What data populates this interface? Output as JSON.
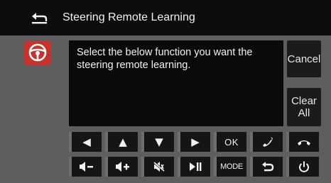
{
  "header": {
    "title": "Steering Remote Learning",
    "back_icon": "back-arrow-icon"
  },
  "panel": {
    "icon": "steering-wheel-icon",
    "message": "Select the below function you want the steering remote learning.",
    "cancel_label": "Cancel",
    "clear_all_label": "Clear All"
  },
  "keys_row1": [
    {
      "name": "key-seek-left",
      "icon": "left-triangle-icon",
      "glyph": "◀"
    },
    {
      "name": "key-up",
      "icon": "up-triangle-icon",
      "glyph": "▲"
    },
    {
      "name": "key-down",
      "icon": "down-triangle-icon",
      "glyph": "▼"
    },
    {
      "name": "key-seek-right",
      "icon": "right-triangle-icon",
      "glyph": "▶"
    },
    {
      "name": "key-ok",
      "label": "OK"
    },
    {
      "name": "key-call",
      "icon": "phone-answer-icon"
    },
    {
      "name": "key-hangup",
      "icon": "phone-hangup-icon"
    }
  ],
  "keys_row2": [
    {
      "name": "key-volume-down",
      "icon": "volume-down-icon"
    },
    {
      "name": "key-volume-up",
      "icon": "volume-up-icon"
    },
    {
      "name": "key-mute",
      "icon": "mute-icon"
    },
    {
      "name": "key-play-pause",
      "icon": "play-pause-icon"
    },
    {
      "name": "key-mode",
      "label": "MODE"
    },
    {
      "name": "key-return",
      "icon": "return-arrow-icon"
    },
    {
      "name": "key-power",
      "icon": "power-icon"
    }
  ],
  "colors": {
    "header_bg": "#0d0d0d",
    "panel_bg": "#5e5e5e",
    "accent_red": "#c8312c",
    "key_bg": "#151515"
  }
}
